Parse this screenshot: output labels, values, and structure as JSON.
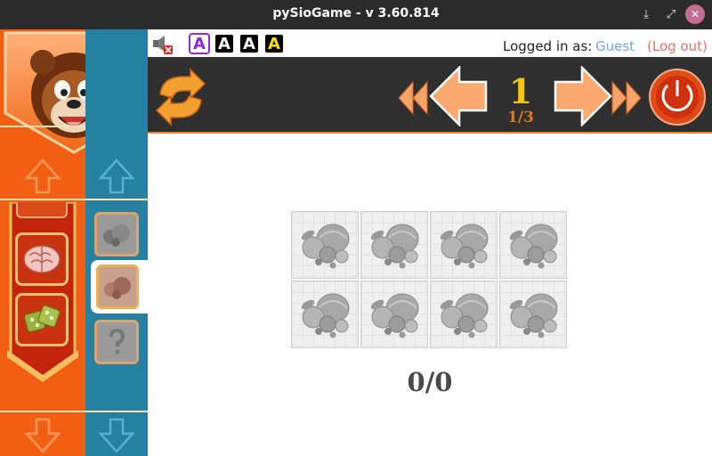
{
  "window": {
    "title": "pySioGame - v 3.60.814"
  },
  "window_controls": {
    "minimize": "⤓",
    "maximize": "⤢",
    "close": "✕"
  },
  "status": {
    "font_buttons": [
      "A",
      "A",
      "A",
      "A"
    ],
    "logged_in_label": "Logged in as:",
    "user": "Guest",
    "logout": "(Log out)"
  },
  "level": {
    "number": "1",
    "fraction": "1/3"
  },
  "game": {
    "score": "0/0",
    "tile_count": 8
  },
  "colors": {
    "orange_panel": "#f25f12",
    "teal_panel": "#2680a0",
    "toolbar": "#2f2f2f",
    "level_number": "#f2c21a",
    "level_fraction": "#e07a20",
    "user_link": "#6fa8dc",
    "logout_link": "#e0736b"
  },
  "icons": [
    "lion-mascot-icon",
    "mute-speaker-icon",
    "refresh-icon",
    "fast-back-icon",
    "back-arrow-icon",
    "forward-arrow-icon",
    "fast-forward-icon",
    "exit-power-icon",
    "brain-icon",
    "dice-icon",
    "fruits-icon",
    "question-mark-icon"
  ]
}
